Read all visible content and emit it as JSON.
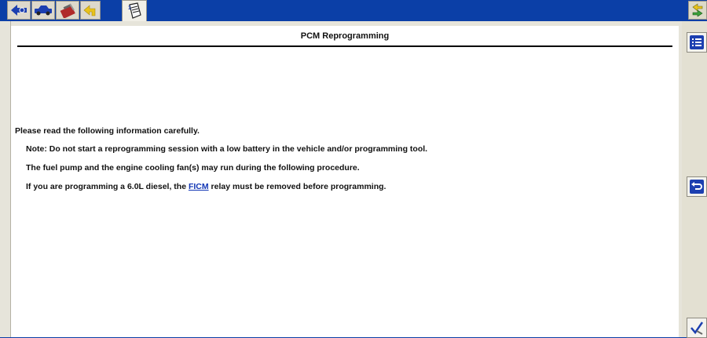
{
  "toolbar": {
    "icons": [
      "back-arrow-icon",
      "vehicle-icon",
      "toolbox-icon",
      "return-arrow-icon",
      "document-icon",
      "switch-arrows-icon"
    ]
  },
  "page": {
    "title": "PCM Reprogramming",
    "intro": "Please read the following information carefully.",
    "note": "Note: Do not start a reprogramming session with a low battery in the vehicle and/or programming tool.",
    "fuel": "The fuel pump and the engine cooling fan(s) may run during the following procedure.",
    "diesel_before": "If you are programming a 6.0L diesel, the ",
    "diesel_link": "FICM",
    "diesel_after": " relay must be removed before programming."
  },
  "side": {
    "icons": [
      "list-icon",
      "back-icon",
      "check-icon"
    ]
  },
  "colors": {
    "toolbar_bg": "#0b3fa7",
    "link": "#1236b5",
    "icon_blue": "#1c3fb0",
    "icon_yellow": "#e8c21a"
  }
}
